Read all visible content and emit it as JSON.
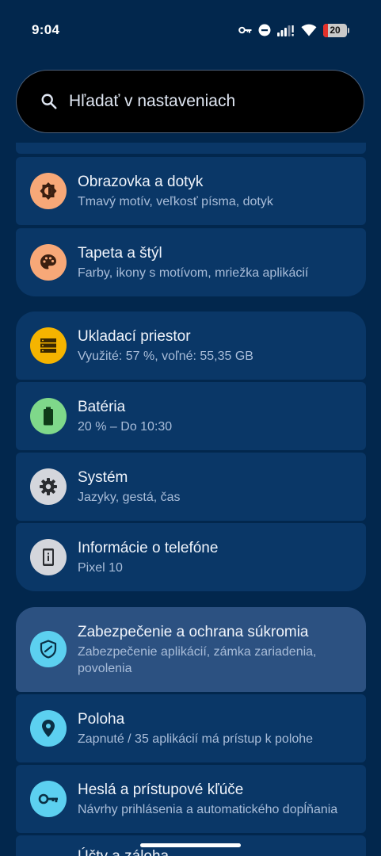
{
  "status_bar": {
    "time": "9:04",
    "battery_level": "20",
    "battery_fraction": 0.2,
    "icons": [
      "key-icon",
      "do-not-disturb-icon",
      "signal-icon",
      "wifi-icon",
      "battery-icon"
    ]
  },
  "search": {
    "placeholder": "Hľadať v nastaveniach"
  },
  "colors": {
    "background": "#02274d",
    "card": "#0a3767",
    "card_highlight": "#2c5181",
    "icon_display": "#f7a878",
    "icon_storage": "#f5b400",
    "icon_battery": "#7fd88a",
    "icon_system": "#d4d6dc",
    "icon_security": "#5cd0f0"
  },
  "settings": [
    {
      "title": "Obrazovka a dotyk",
      "subtitle": "Tmavý motív, veľkosť písma, dotyk",
      "icon": "display-brightness-icon"
    },
    {
      "title": "Tapeta a štýl",
      "subtitle": "Farby, ikony s motívom, mriežka aplikácií",
      "icon": "palette-icon"
    },
    {
      "title": "Ukladací priestor",
      "subtitle": "Využité: 57 %, voľné: 55,35 GB",
      "icon": "storage-icon"
    },
    {
      "title": "Batéria",
      "subtitle": "20 % – Do 10:30",
      "icon": "battery-icon"
    },
    {
      "title": "Systém",
      "subtitle": "Jazyky, gestá, čas",
      "icon": "gear-icon"
    },
    {
      "title": "Informácie o telefóne",
      "subtitle": "Pixel 10",
      "icon": "phone-info-icon"
    },
    {
      "title": "Zabezpečenie a ochrana súkromia",
      "subtitle": "Zabezpečenie aplikácií, zámka zariadenia, povolenia",
      "icon": "shield-icon"
    },
    {
      "title": "Poloha",
      "subtitle": "Zapnuté / 35 aplikácií má prístup k polohe",
      "icon": "location-pin-icon"
    },
    {
      "title": "Heslá a prístupové kľúče",
      "subtitle": "Návrhy prihlásenia a automatického dopĺňania",
      "icon": "key-icon"
    },
    {
      "title": "Účty a záloha",
      "subtitle": "",
      "icon": "account-icon"
    }
  ]
}
